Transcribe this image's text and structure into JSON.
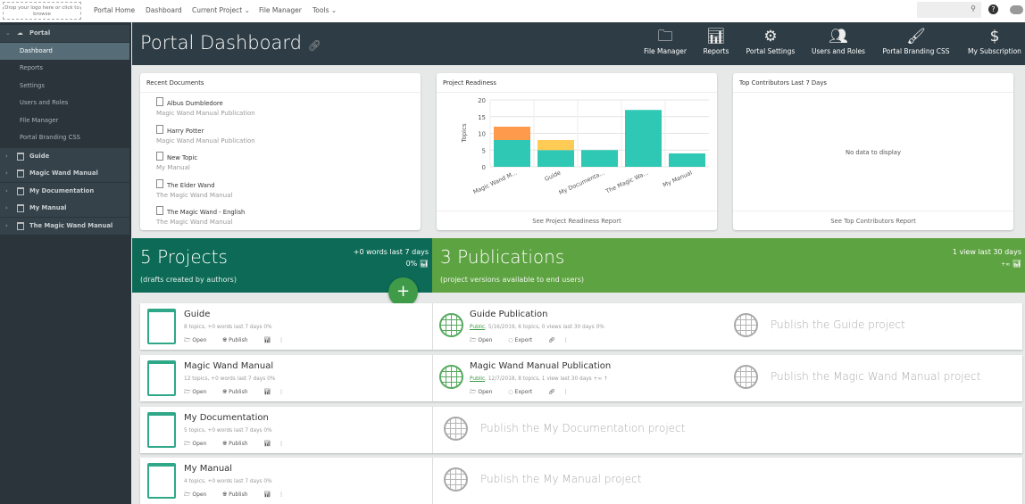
{
  "topbar": {
    "logo_text": "Drop your logo here or click to browse",
    "nav": [
      "Portal Home",
      "Dashboard",
      "Current Project ⌄",
      "File Manager",
      "Tools ⌄"
    ],
    "search_placeholder": ""
  },
  "sidebar": {
    "portal": "Portal",
    "portal_items": [
      "Dashboard",
      "Reports",
      "Settings",
      "Users and Roles",
      "File Manager",
      "Portal Branding CSS"
    ],
    "projects": [
      "Guide",
      "Magic Wand Manual",
      "My Documentation",
      "My Manual",
      "The Magic Wand Manual"
    ]
  },
  "header": {
    "title": "Portal Dashboard",
    "buttons": [
      {
        "label": "File Manager",
        "icon": "folder-icon"
      },
      {
        "label": "Reports",
        "icon": "bar-chart-icon"
      },
      {
        "label": "Portal Settings",
        "icon": "gear-icon"
      },
      {
        "label": "Users and Roles",
        "icon": "users-icon"
      },
      {
        "label": "Portal Branding CSS",
        "icon": "brush-icon"
      },
      {
        "label": "My Subscription",
        "icon": "dollar-cycle-icon"
      }
    ]
  },
  "recent": {
    "title": "Recent Documents",
    "docs": [
      {
        "title": "Albus Dumbledore",
        "source": "Magic Wand Manual Publication"
      },
      {
        "title": "Harry Potter",
        "source": "Magic Wand Manual Publication"
      },
      {
        "title": "New Topic",
        "source": "My Manual"
      },
      {
        "title": "The Elder Wand",
        "source": "The Magic Wand Manual"
      },
      {
        "title": "The Magic Wand - English",
        "source": "The Magic Wand Manual"
      }
    ]
  },
  "readiness": {
    "title": "Project Readiness",
    "footer": "See Project Readiness Report"
  },
  "contributors": {
    "title": "Top Contributors Last 7 Days",
    "empty": "No data to display",
    "footer": "See Top Contributors Report"
  },
  "chart_data": {
    "type": "bar",
    "stacked": true,
    "categories": [
      "Magic Wand M...",
      "Guide",
      "My Documenta...",
      "The Magic Wa...",
      "My Manual"
    ],
    "series": [
      {
        "values": [
          8,
          5,
          5,
          17,
          4
        ],
        "color": "#2ec8b4"
      },
      {
        "values": [
          4,
          0,
          0,
          0,
          0
        ],
        "color": "#fd9a4c"
      },
      {
        "values": [
          0,
          3,
          0,
          0,
          0
        ],
        "color": "#fecb55"
      }
    ],
    "ylabel": "Topics",
    "ylim": [
      0,
      20
    ],
    "yticks": [
      0,
      5,
      10,
      15,
      20
    ],
    "grid": true
  },
  "projects_band": {
    "title": "5 Projects",
    "subtitle": "(drafts created by authors)",
    "stat1": "+0 words last 7 days",
    "stat2": "0%"
  },
  "pubs_band": {
    "title": "3 Publications",
    "subtitle": "(project versions available to end users)",
    "stat1": "1 view last 30 days",
    "stat2": "+∞"
  },
  "actions": {
    "open": "Open",
    "publish": "Publish",
    "export": "Export"
  },
  "projects": [
    {
      "name": "Guide",
      "meta": "8 topics, +0 words last 7 days 0%",
      "pub": {
        "name": "Guide Publication",
        "status": "Public",
        "meta": ", 5/16/2019, 6 topics, 0 views last 30 days 0%"
      },
      "placeholder": "Publish the Guide project"
    },
    {
      "name": "Magic Wand Manual",
      "meta": "12 topics, +0 words last 7 days 0%",
      "pub": {
        "name": "Magic Wand Manual Publication",
        "status": "Public",
        "meta": ", 12/7/2018, 8 topics, 1 view last 30 days +∞ ↑"
      },
      "placeholder": "Publish the Magic Wand Manual project"
    },
    {
      "name": "My Documentation",
      "meta": "5 topics, +0 words last 7 days 0%",
      "placeholder": "Publish the My Documentation project"
    },
    {
      "name": "My Manual",
      "meta": "4 topics, +0 words last 7 days 0%",
      "placeholder": "Publish the My Manual project"
    }
  ]
}
